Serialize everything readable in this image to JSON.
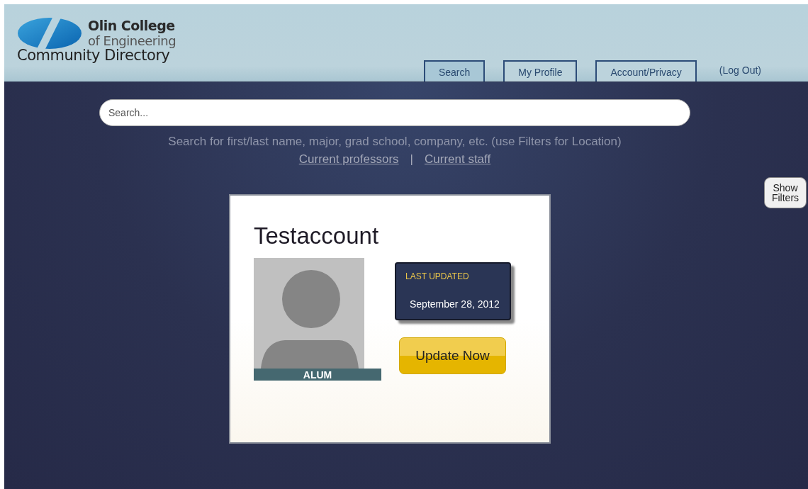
{
  "header": {
    "logo_line_1": "Olin College",
    "logo_line_2": "of Engineering",
    "site_title": "Community Directory"
  },
  "tabs": [
    {
      "label": "Search",
      "selected": true
    },
    {
      "label": "My Profile",
      "selected": false
    },
    {
      "label": "Account/Privacy",
      "selected": false
    }
  ],
  "logout": "(Log Out)",
  "search": {
    "placeholder": "Search...",
    "hint": "Search for first/last name, major, grad school, company, etc. (use Filters for Location)",
    "links": [
      "Current professors",
      "Current staff"
    ],
    "separator": "|"
  },
  "filters_button": "Show Filters",
  "profile": {
    "name": "Testaccount",
    "role": "ALUM",
    "last_updated_label": "LAST UPDATED",
    "last_updated": "September 28, 2012",
    "update_button": "Update Now"
  }
}
